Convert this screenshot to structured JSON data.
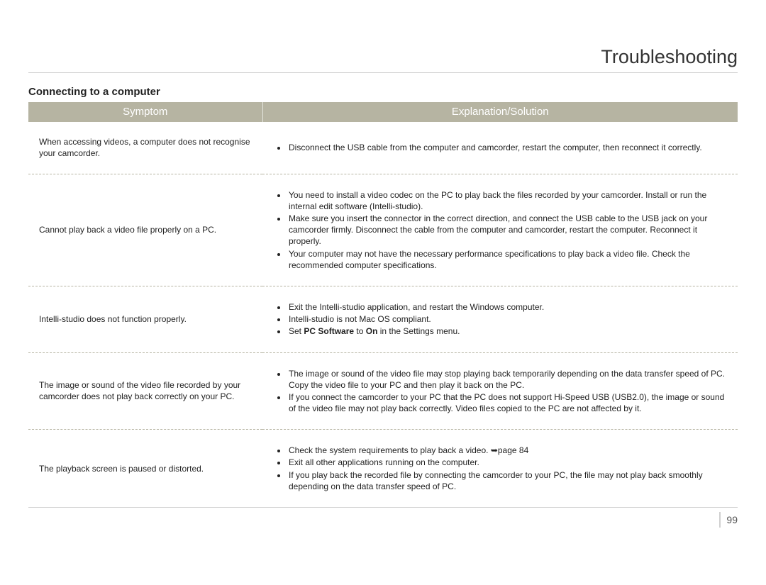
{
  "page": {
    "title": "Troubleshooting",
    "section_heading": "Connecting to a computer",
    "page_number": "99"
  },
  "table": {
    "headers": {
      "symptom": "Symptom",
      "explanation": "Explanation/Solution"
    },
    "rows": [
      {
        "symptom": "When accessing videos, a computer does not recognise your camcorder.",
        "bullets": [
          "Disconnect the USB cable from the computer and camcorder, restart the computer, then reconnect it correctly."
        ]
      },
      {
        "symptom": "Cannot play back a video file properly on a PC.",
        "bullets": [
          "You need to install a video codec on the PC to play back the files recorded by your camcorder. Install or run the internal edit software (Intelli-studio).",
          "Make sure you insert the connector in the correct direction, and connect the USB cable to the USB jack on your camcorder firmly. Disconnect the cable from the computer and camcorder, restart the computer. Reconnect it properly.",
          "Your computer may not have the necessary performance specifications to play back a video file. Check the recommended computer specifications."
        ]
      },
      {
        "symptom": "Intelli-studio does not function properly.",
        "bullets": [
          "Exit the Intelli-studio application, and restart the Windows computer.",
          "Intelli-studio is not Mac OS compliant.",
          {
            "parts": [
              {
                "text": "Set "
              },
              {
                "text": "PC Software",
                "bold": true
              },
              {
                "text": " to "
              },
              {
                "text": "On",
                "bold": true
              },
              {
                "text": " in the Settings menu."
              }
            ]
          }
        ]
      },
      {
        "symptom": "The image or sound of the video file recorded by your camcorder does not play back correctly on your PC.",
        "bullets": [
          "The image or sound of the video file may stop playing back temporarily depending on the data transfer speed of PC. Copy the video file to your PC and then play it back on the PC.",
          "If you connect the camcorder to your PC that the PC does not support Hi-Speed USB (USB2.0), the image or sound of the video file may not play back correctly. Video files copied to the PC are not affected by it."
        ]
      },
      {
        "symptom": "The playback screen is paused or distorted.",
        "bullets": [
          {
            "parts": [
              {
                "text": "Check the system requirements to play back a video. "
              },
              {
                "icon": "arrow-right",
                "text": "➥"
              },
              {
                "text": "page 84"
              }
            ]
          },
          "Exit all other applications running on the computer.",
          "If you play back the recorded file by connecting the camcorder to your PC, the file may not play back smoothly depending on the data transfer speed of PC."
        ]
      }
    ]
  }
}
